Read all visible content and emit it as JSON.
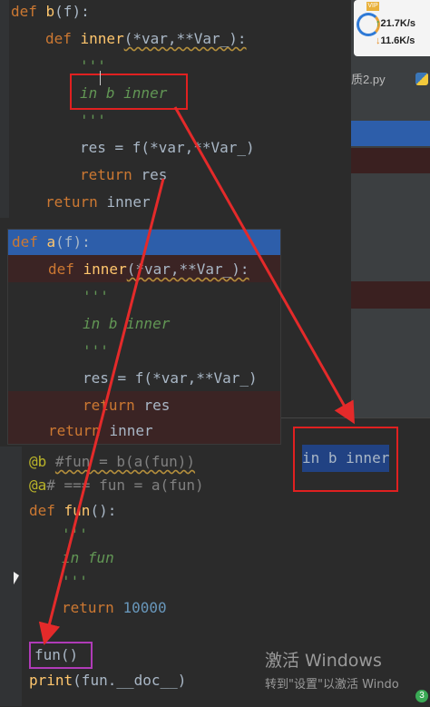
{
  "net": {
    "badge": "VIP",
    "up": "21.7K/s",
    "down": "11.6K/s"
  },
  "tab_label": "质2.py",
  "editor_top": {
    "lines": [
      {
        "kw": "def ",
        "fn": "b",
        "rest": "(f):"
      },
      {
        "kw": "def ",
        "fn": "inner",
        "rest": "(*var,**Var_):"
      },
      {
        "doc": "'''"
      },
      {
        "doc": "in b inner"
      },
      {
        "doc": "'''"
      },
      {
        "tx": "res = f(*var,**Var_)"
      },
      {
        "kw": "return ",
        "rest": "res"
      },
      {
        "kw": "return ",
        "rest": "inner"
      }
    ]
  },
  "editor_a": {
    "lines": [
      {
        "kw": "def ",
        "fn": "a",
        "rest": "(f):"
      },
      {
        "kw": "def ",
        "fn": "inner",
        "rest": "(*var,**Var_):"
      },
      {
        "doc": "'''"
      },
      {
        "doc": "in b inner"
      },
      {
        "doc": "'''"
      },
      {
        "tx": "res = f(*var,**Var_)"
      },
      {
        "kw": "return ",
        "rest": "res"
      },
      {
        "kw": "return ",
        "rest": "inner"
      }
    ]
  },
  "editor_bottom": {
    "deco1": "@b",
    "cmt1": "#fun = b(a(fun))",
    "deco2": "@a",
    "cmt2": "# === fun = a(fun)",
    "def_kw": "def ",
    "def_name": "fun",
    "def_rest": "():",
    "doc_open": "'''",
    "doc_text": "in fun",
    "doc_close": "'''",
    "ret_kw": "return ",
    "ret_val": "10000",
    "call": "fun()",
    "print_fn": "print",
    "print_rest": "(fun.__doc__)"
  },
  "output_text": "in b inner",
  "watermark": {
    "line1": "激活 Windows",
    "line2": "转到\"设置\"以激活 Windo"
  },
  "tray_badge": "3"
}
